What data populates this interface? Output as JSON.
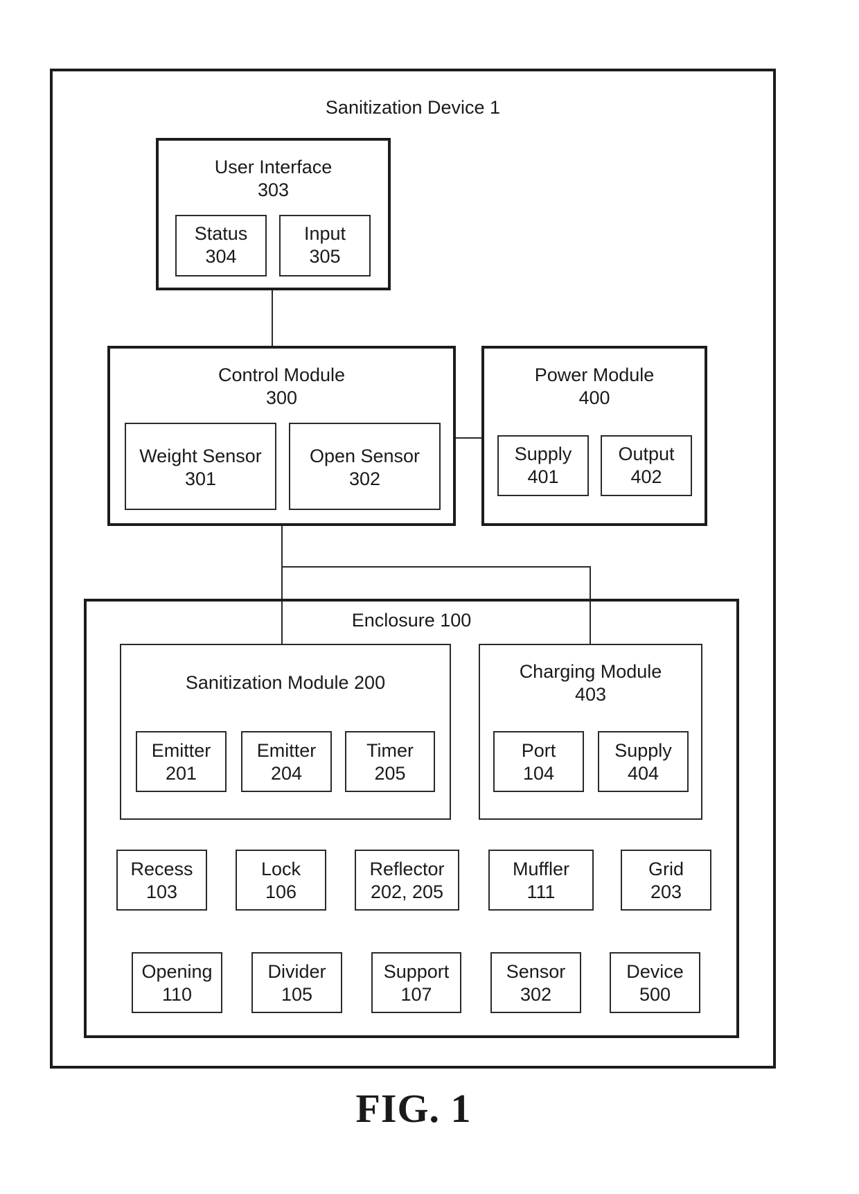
{
  "figure_label": "FIG. 1",
  "device": {
    "title": "Sanitization Device 1",
    "user_interface": {
      "name": "User Interface",
      "ref": "303",
      "children": [
        {
          "name": "Status",
          "ref": "304"
        },
        {
          "name": "Input",
          "ref": "305"
        }
      ]
    },
    "control_module": {
      "name": "Control Module",
      "ref": "300",
      "children": [
        {
          "name": "Weight Sensor",
          "ref": "301"
        },
        {
          "name": "Open Sensor",
          "ref": "302"
        }
      ]
    },
    "power_module": {
      "name": "Power Module",
      "ref": "400",
      "children": [
        {
          "name": "Supply",
          "ref": "401"
        },
        {
          "name": "Output",
          "ref": "402"
        }
      ]
    },
    "enclosure": {
      "title": "Enclosure 100",
      "sanitization_module": {
        "title": "Sanitization Module 200",
        "children": [
          {
            "name": "Emitter",
            "ref": "201"
          },
          {
            "name": "Emitter",
            "ref": "204"
          },
          {
            "name": "Timer",
            "ref": "205"
          }
        ]
      },
      "charging_module": {
        "name": "Charging Module",
        "ref": "403",
        "children": [
          {
            "name": "Port",
            "ref": "104"
          },
          {
            "name": "Supply",
            "ref": "404"
          }
        ]
      },
      "row1": [
        {
          "name": "Recess",
          "ref": "103"
        },
        {
          "name": "Lock",
          "ref": "106"
        },
        {
          "name": "Reflector",
          "ref": "202, 205"
        },
        {
          "name": "Muffler",
          "ref": "111"
        },
        {
          "name": "Grid",
          "ref": "203"
        }
      ],
      "row2": [
        {
          "name": "Opening",
          "ref": "110"
        },
        {
          "name": "Divider",
          "ref": "105"
        },
        {
          "name": "Support",
          "ref": "107"
        },
        {
          "name": "Sensor",
          "ref": "302"
        },
        {
          "name": "Device",
          "ref": "500"
        }
      ]
    }
  }
}
